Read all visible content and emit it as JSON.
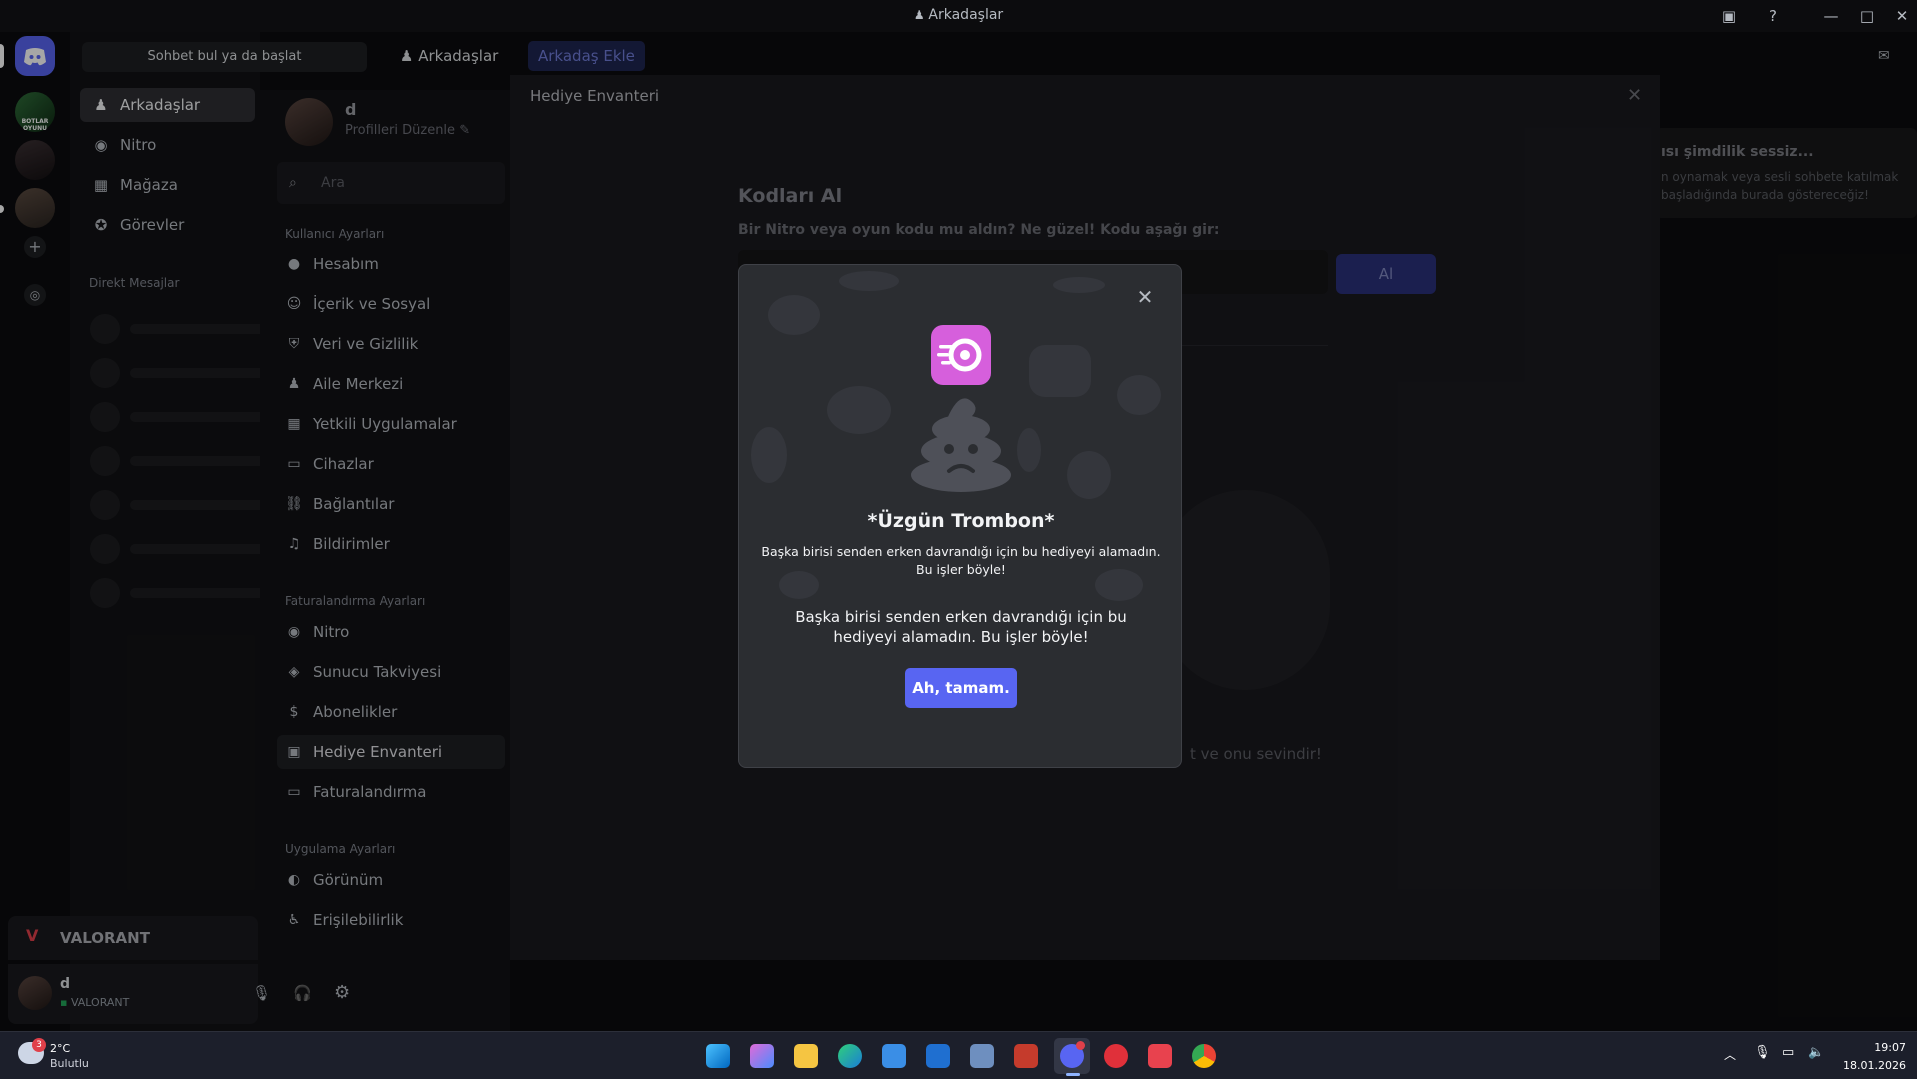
{
  "window": {
    "title": "Arkadaşlar"
  },
  "top_tabs": {
    "search_placeholder": "Sohbet bul ya da başlat",
    "friends": "Arkadaşlar",
    "add_friend": "Arkadaş Ekle"
  },
  "dm_nav": {
    "items": [
      {
        "label": "Arkadaşlar",
        "icon": "friends-icon"
      },
      {
        "label": "Nitro",
        "icon": "nitro-icon"
      },
      {
        "label": "Mağaza",
        "icon": "store-icon"
      },
      {
        "label": "Görevler",
        "icon": "quests-icon"
      }
    ],
    "direct_messages": "Direkt Mesajlar"
  },
  "server_rail": {
    "server1_badge": "BOTLAR OYUNU"
  },
  "activity": {
    "game_name": "VALORANT"
  },
  "user_panel": {
    "username": "d",
    "status": "VALORANT"
  },
  "settings": {
    "profile_name": "d",
    "profile_edit": "Profilleri Düzenle",
    "search_placeholder": "Ara",
    "section_user": "Kullanıcı Ayarları",
    "user_items": [
      "Hesabım",
      "İçerik ve Sosyal",
      "Veri ve Gizlilik",
      "Aile Merkezi",
      "Yetkili Uygulamalar",
      "Cihazlar",
      "Bağlantılar",
      "Bildirimler"
    ],
    "section_billing": "Faturalandırma Ayarları",
    "billing_items": [
      "Nitro",
      "Sunucu Takviyesi",
      "Abonelikler",
      "Hediye Envanteri",
      "Faturalandırma"
    ],
    "section_app": "Uygulama Ayarları",
    "app_items": [
      "Görünüm",
      "Erişilebilirlik"
    ]
  },
  "content": {
    "page_title": "Hediye Envanteri",
    "codes_title": "Kodları Al",
    "codes_subtitle": "Bir Nitro veya oyun kodu mu aldın? Ne güzel! Kodu aşağı gir:",
    "redeem_button": "Al",
    "empty_text_tail": "t ve onu sevindir!"
  },
  "active_now": {
    "title_fragment": "ısı şimdilik sessiz...",
    "desc_line1": "n oynamak veya sesli sohbete katılmak",
    "desc_line2": "başladığında burada göstereceğiz!"
  },
  "modal": {
    "title": "*Üzgün Trombon*",
    "small_text": "Başka birisi senden erken davrandığı için bu hediyeyi alamadın. Bu işler böyle!",
    "large_text": "Başka birisi senden erken davrandığı için bu hediyeyi alamadın. Bu işler böyle!",
    "button": "Ah, tamam."
  },
  "taskbar": {
    "temperature": "2°C",
    "weather": "Bulutlu",
    "weather_badge": "3",
    "time": "19:07",
    "date": "18.01.2026"
  },
  "colors": {
    "blurple": "#5865f2",
    "nitro_pink": "#d65fdc",
    "background": "#0c0c0e"
  }
}
